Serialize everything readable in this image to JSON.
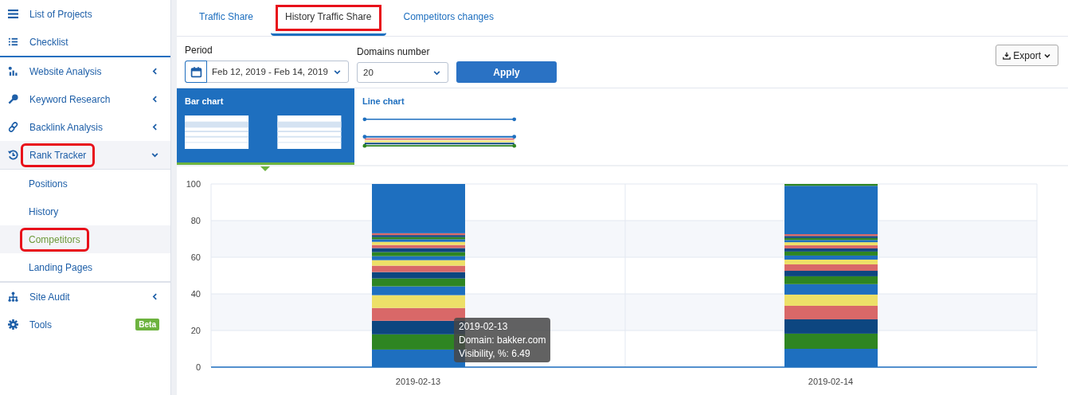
{
  "sidebar": {
    "top_items": [
      {
        "label": "List of Projects"
      },
      {
        "label": "Checklist"
      }
    ],
    "sections": [
      {
        "label": "Website Analysis",
        "expanded": false,
        "highlighted": false
      },
      {
        "label": "Keyword Research",
        "expanded": false,
        "highlighted": false
      },
      {
        "label": "Backlink Analysis",
        "expanded": false,
        "highlighted": false
      },
      {
        "label": "Rank Tracker",
        "expanded": true,
        "highlighted": true,
        "children": [
          {
            "label": "Positions",
            "selected": false,
            "highlighted": false
          },
          {
            "label": "History",
            "selected": false,
            "highlighted": false
          },
          {
            "label": "Competitors",
            "selected": true,
            "highlighted": true
          },
          {
            "label": "Landing Pages",
            "selected": false,
            "highlighted": false
          }
        ]
      },
      {
        "label": "Site Audit",
        "expanded": false,
        "highlighted": false
      },
      {
        "label": "Tools",
        "badge": "Beta",
        "highlighted": false
      }
    ]
  },
  "tabs": [
    {
      "label": "Traffic Share",
      "selected": false,
      "highlighted": false
    },
    {
      "label": "History Traffic Share",
      "selected": true,
      "highlighted": true
    },
    {
      "label": "Competitors changes",
      "selected": false,
      "highlighted": false
    }
  ],
  "filters": {
    "period": {
      "label": "Period",
      "value": "Feb 12, 2019 - Feb 14, 2019"
    },
    "domains": {
      "label": "Domains number",
      "value": "20"
    },
    "apply": "Apply",
    "export": "Export"
  },
  "chart_types": [
    {
      "label": "Bar chart",
      "selected": true
    },
    {
      "label": "Line chart",
      "selected": false
    }
  ],
  "chart": {
    "chart_data": {
      "type": "bar",
      "stacked": true,
      "grid": true,
      "categories": [
        "2019-02-13",
        "2019-02-14"
      ],
      "ylim": [
        0,
        100
      ],
      "yticks": [
        0,
        20,
        40,
        60,
        80,
        100
      ],
      "series": [
        {
          "color": "#1e6fbf",
          "values": [
            9.6,
            10
          ]
        },
        {
          "color": "#2e8522",
          "values": [
            8.3,
            8.3
          ]
        },
        {
          "color": "#0d4680",
          "values": [
            7.4,
            7.8
          ]
        },
        {
          "color": "#d96868",
          "values": [
            7,
            7.4
          ]
        },
        {
          "color": "#ede068",
          "values": [
            7,
            6.1
          ]
        },
        {
          "color": "#1e6fbf",
          "values": [
            4.8,
            5.7
          ]
        },
        {
          "color": "#2e8522",
          "values": [
            4.3,
            4.3
          ]
        },
        {
          "color": "#0d4680",
          "values": [
            3.5,
            3
          ]
        },
        {
          "color": "#d96868",
          "values": [
            3.5,
            3.5
          ]
        },
        {
          "color": "#ede068",
          "values": [
            3,
            2.6
          ]
        },
        {
          "color": "#1e6fbf",
          "values": [
            2.2,
            2.2
          ]
        },
        {
          "color": "#2e8522",
          "values": [
            2.2,
            2.2
          ]
        },
        {
          "color": "#0d4680",
          "values": [
            2.2,
            1.7
          ]
        },
        {
          "color": "#d96868",
          "values": [
            1.7,
            1.7
          ]
        },
        {
          "color": "#ede068",
          "values": [
            1.7,
            1.7
          ]
        },
        {
          "color": "#1e6fbf",
          "values": [
            1.4,
            1.2
          ]
        },
        {
          "color": "#2e8522",
          "values": [
            1.2,
            1.1
          ]
        },
        {
          "color": "#0d4680",
          "values": [
            1.1,
            1.1
          ]
        },
        {
          "color": "#d96868",
          "values": [
            1,
            1
          ]
        },
        {
          "color": "#1e6fbf",
          "values": [
            26.9,
            26.4
          ]
        },
        {
          "color": "#2e8522",
          "values": [
            0,
            1
          ]
        }
      ]
    },
    "tooltip": {
      "lines": [
        "2019-02-13",
        "Domain: bakker.com",
        "Visibility, %: 6.49"
      ]
    }
  }
}
